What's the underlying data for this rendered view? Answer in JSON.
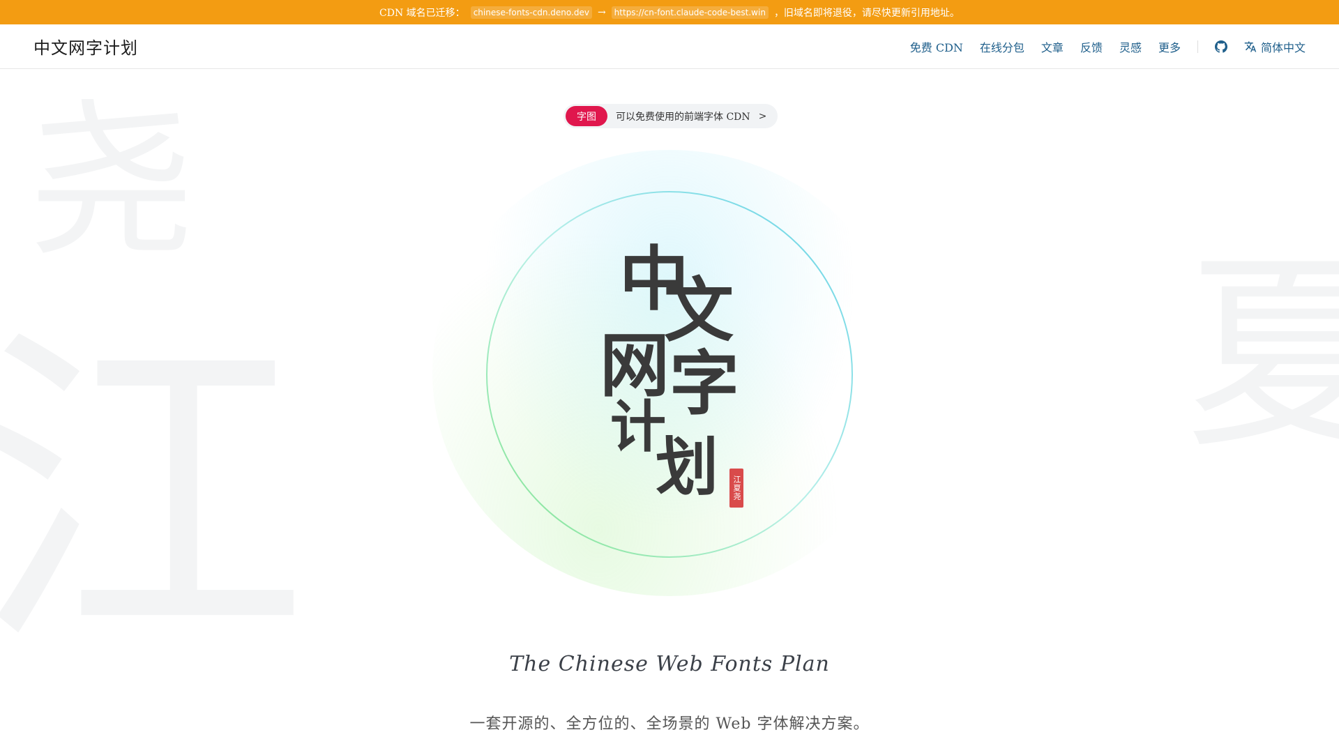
{
  "banner": {
    "prefix": "CDN 域名已迁移：",
    "old_domain": "chinese-fonts-cdn.deno.dev",
    "arrow": "→",
    "new_domain": "https://cn-font.claude-code-best.win",
    "suffix": "，旧域名即将退役，请尽快更新引用地址。",
    "color": "#f39c12"
  },
  "header": {
    "title": "中文网字计划",
    "nav": [
      {
        "label": "免费 CDN"
      },
      {
        "label": "在线分包"
      },
      {
        "label": "文章"
      },
      {
        "label": "反馈"
      },
      {
        "label": "灵感"
      },
      {
        "label": "更多"
      }
    ],
    "github_icon": "github-icon",
    "language_icon": "translate-icon",
    "language_label": "简体中文",
    "link_color": "#1f5f8b"
  },
  "background_glyphs": [
    "尧",
    "江",
    "夏"
  ],
  "pill": {
    "tag": "字图",
    "text": "可以免费使用的前端字体 CDN",
    "chevron": ">",
    "tag_color": "#e0174d"
  },
  "hero": {
    "chars": [
      "中",
      "文",
      "网",
      "字",
      "计",
      "划"
    ],
    "seal_text": "江夏尧"
  },
  "subtitle_en": "The Chinese Web Fonts Plan",
  "tagline_cn": "一套开源的、全方位的、全场景的 Web 字体解决方案。"
}
